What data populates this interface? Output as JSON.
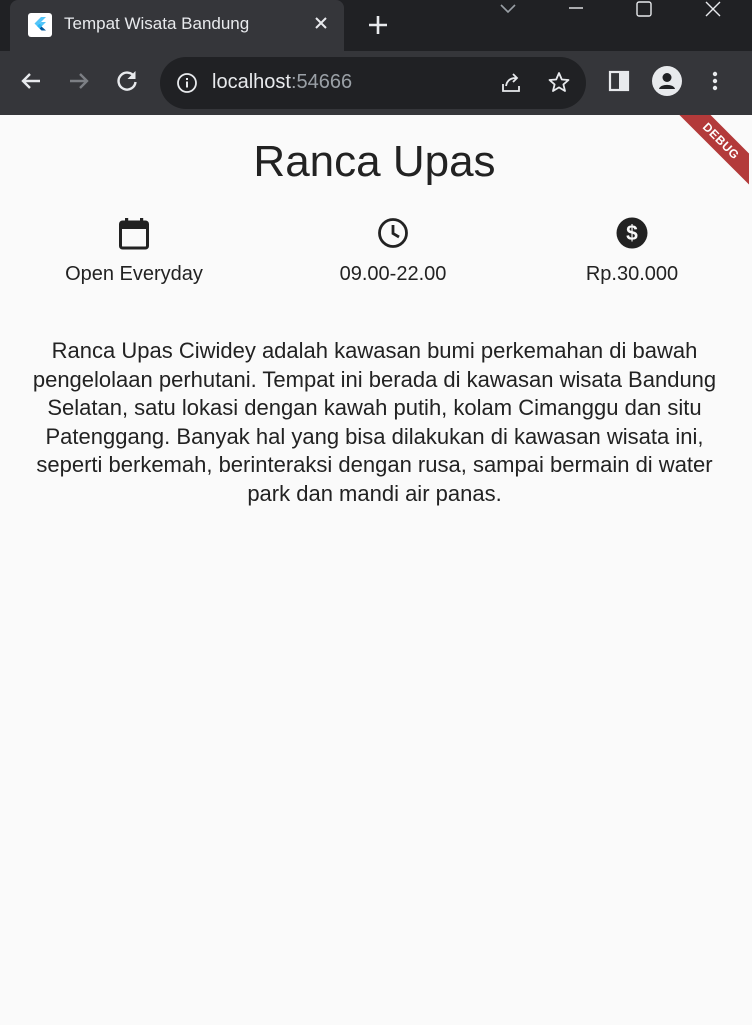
{
  "browser": {
    "tab_title": "Tempat Wisata Bandung",
    "url_host": "localhost",
    "url_port": ":54666"
  },
  "page": {
    "debug_label": "DEBUG",
    "title": "Ranca Upas",
    "info": [
      {
        "icon": "calendar-icon",
        "label": "Open Everyday"
      },
      {
        "icon": "clock-icon",
        "label": "09.00-22.00"
      },
      {
        "icon": "dollar-icon",
        "label": "Rp.30.000"
      }
    ],
    "description": "Ranca Upas Ciwidey adalah kawasan bumi perkemahan di bawah pengelolaan perhutani. Tempat ini berada di kawasan wisata Bandung Selatan, satu lokasi dengan kawah putih, kolam Cimanggu dan situ Patenggang. Banyak hal yang bisa dilakukan di kawasan wisata ini, seperti berkemah, berinteraksi dengan rusa, sampai bermain di water park dan mandi air panas."
  },
  "colors": {
    "chrome_dark": "#202124",
    "chrome_tab": "#35363a",
    "page_bg": "#fafafa",
    "debug_banner": "#b33a3a"
  }
}
